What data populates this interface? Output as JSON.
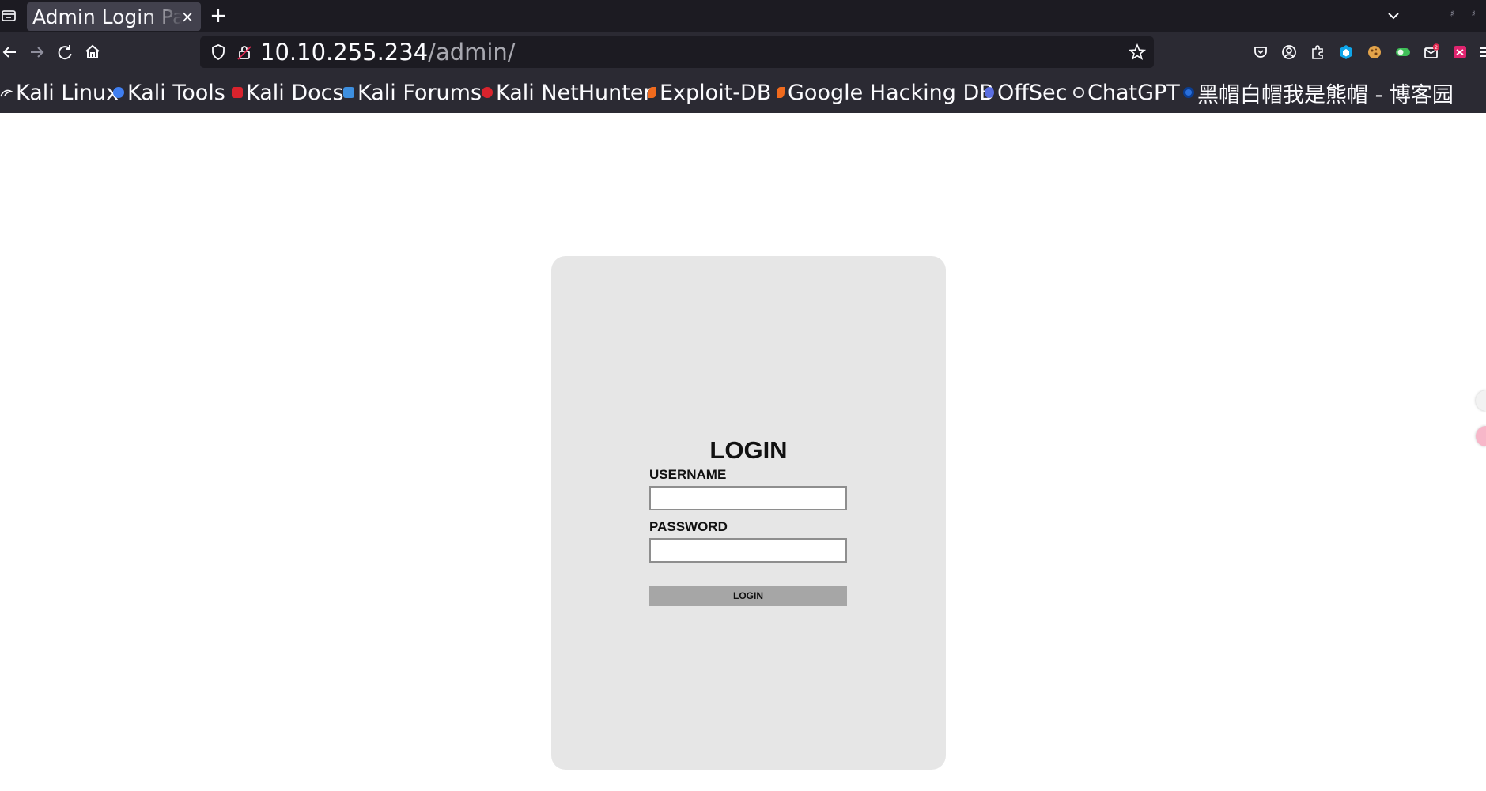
{
  "tab": {
    "title": "Admin Login Page",
    "close_glyph": "×",
    "new_tab_glyph": "+"
  },
  "navbar": {
    "url_host": "10.10.255.234",
    "url_path": "/admin/"
  },
  "extensions": {
    "badge_count": "2"
  },
  "bookmarks": [
    {
      "label": "Kali Linux",
      "icon": "kali-dragon-icon",
      "color": "#3b7ddd"
    },
    {
      "label": "Kali Tools",
      "icon": "kali-tools-icon",
      "color": "#3f7ef0"
    },
    {
      "label": "Kali Docs",
      "icon": "kali-docs-icon",
      "color": "#d9232d"
    },
    {
      "label": "Kali Forums",
      "icon": "kali-forums-icon",
      "color": "#3d8fe0"
    },
    {
      "label": "Kali NetHunter",
      "icon": "kali-nethunter-icon",
      "color": "#d9232d"
    },
    {
      "label": "Exploit-DB",
      "icon": "exploit-db-icon",
      "color": "#f06a1d"
    },
    {
      "label": "Google Hacking DB",
      "icon": "ghdb-icon",
      "color": "#f06a1d"
    },
    {
      "label": "OffSec",
      "icon": "offsec-icon",
      "color": "#5b6ee1"
    },
    {
      "label": "ChatGPT",
      "icon": "chatgpt-icon",
      "color": "#e8e8ec"
    },
    {
      "label": "黑帽白帽我是熊帽 - 博客园",
      "icon": "cnblogs-icon",
      "color": "#2a6fdb"
    }
  ],
  "login": {
    "title": "LOGIN",
    "username_label": "USERNAME",
    "username_value": "",
    "password_label": "PASSWORD",
    "password_value": "",
    "submit_label": "LOGIN"
  },
  "colors": {
    "tabstrip_bg": "#1c1b22",
    "toolbar_bg": "#2b2a33",
    "card_bg": "#e6e6e6",
    "button_bg": "#a6a6a6"
  }
}
